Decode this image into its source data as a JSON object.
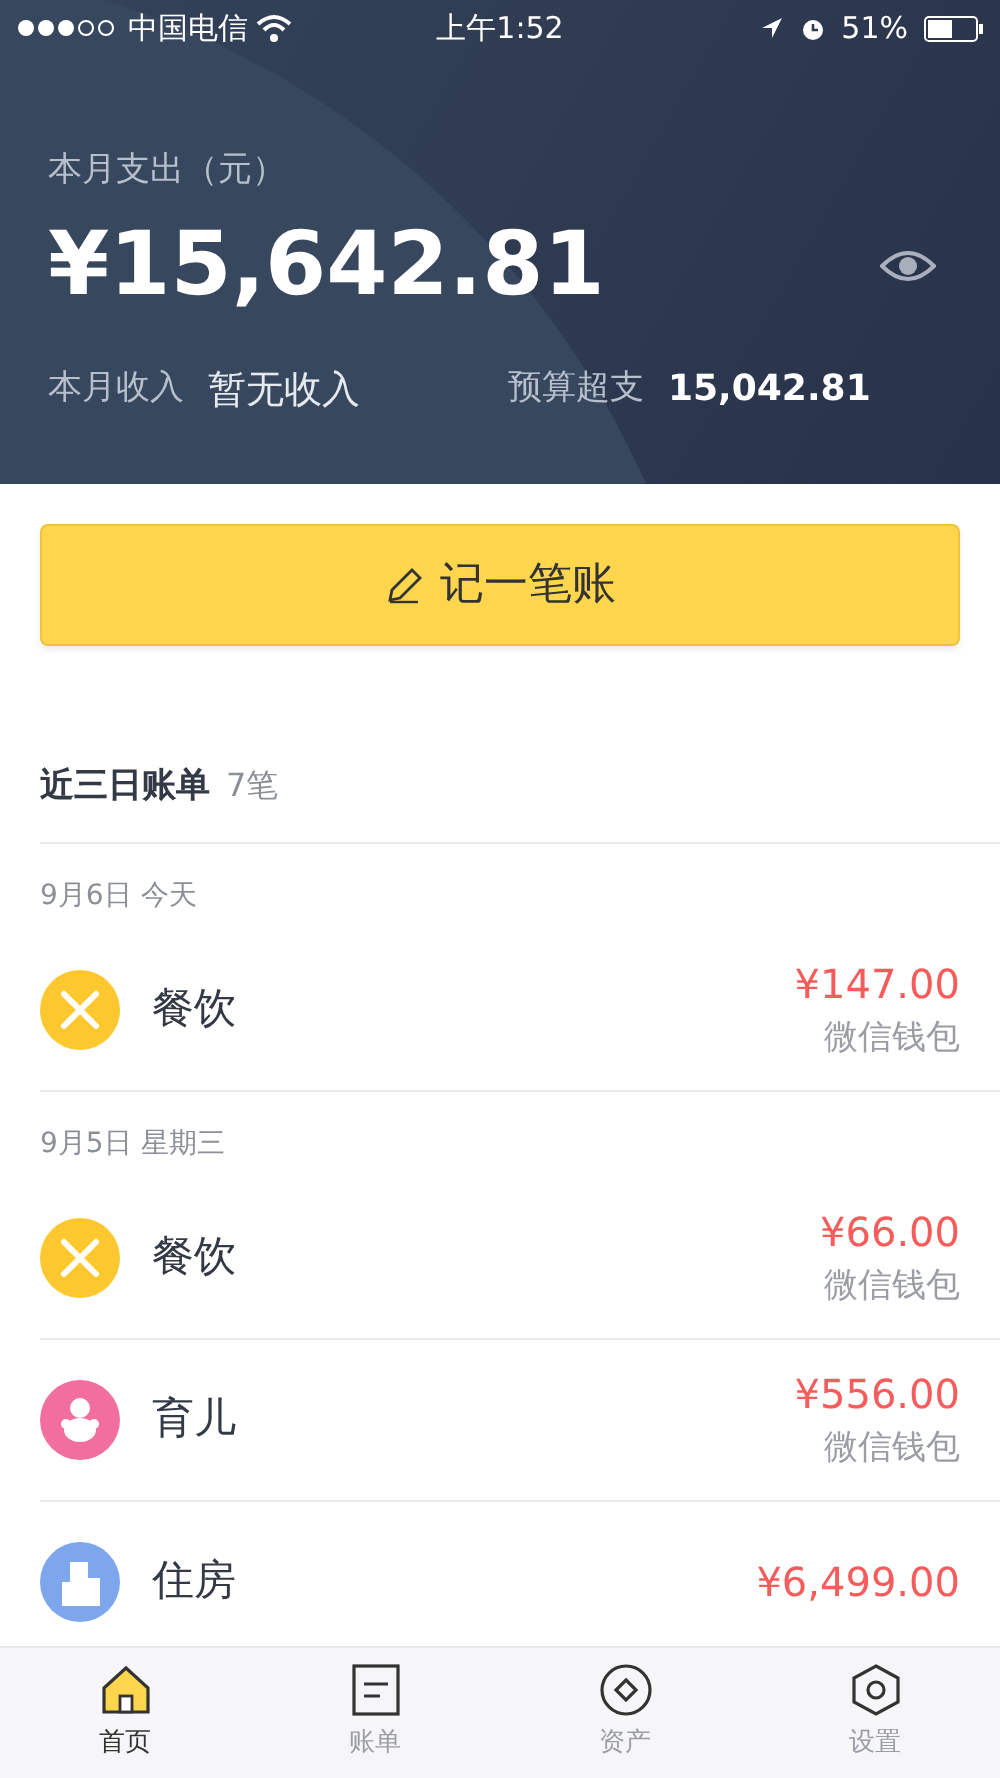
{
  "status_bar": {
    "carrier": "中国电信",
    "time": "上午1:52",
    "battery": "51%"
  },
  "summary": {
    "label": "本月支出（元）",
    "amount": "¥15,642.81",
    "income_label": "本月收入",
    "income_value": "暂无收入",
    "budget_label": "预算超支",
    "budget_value": "15,042.81"
  },
  "record_button": {
    "label": "记一笔账"
  },
  "recent": {
    "title": "近三日账单",
    "count": "7笔"
  },
  "days": [
    {
      "date": "9月6日 今天",
      "entries": [
        {
          "kind": "dining",
          "category": "餐饮",
          "amount": "¥147.00",
          "account": "微信钱包"
        }
      ]
    },
    {
      "date": "9月5日 星期三",
      "entries": [
        {
          "kind": "dining",
          "category": "餐饮",
          "amount": "¥66.00",
          "account": "微信钱包"
        },
        {
          "kind": "childcare",
          "category": "育儿",
          "amount": "¥556.00",
          "account": "微信钱包"
        },
        {
          "kind": "housing",
          "category": "住房",
          "amount": "¥6,499.00"
        }
      ]
    }
  ],
  "tabs": [
    {
      "kind": "home",
      "label": "首页",
      "selected": true
    },
    {
      "kind": "bills",
      "label": "账单",
      "selected": false
    },
    {
      "kind": "assets",
      "label": "资产",
      "selected": false
    },
    {
      "kind": "settings",
      "label": "设置",
      "selected": false
    }
  ]
}
